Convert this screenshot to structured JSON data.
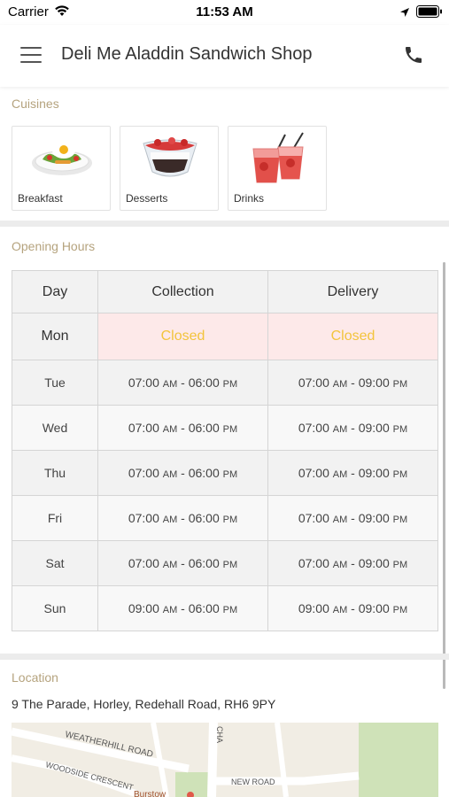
{
  "status_bar": {
    "carrier": "Carrier",
    "time": "11:53 AM"
  },
  "header": {
    "title": "Deli Me Aladdin Sandwich Shop"
  },
  "cuisines": {
    "label": "Cuisines",
    "items": [
      {
        "label": "Breakfast"
      },
      {
        "label": "Desserts"
      },
      {
        "label": "Drinks"
      }
    ]
  },
  "opening_hours": {
    "label": "Opening Hours",
    "headers": {
      "day": "Day",
      "collection": "Collection",
      "delivery": "Delivery"
    },
    "today": {
      "day": "Mon",
      "collection": "Closed",
      "delivery": "Closed"
    },
    "rows": [
      {
        "day": "Tue",
        "collection": {
          "open": "07:00",
          "open_ampm": "AM",
          "close": "06:00",
          "close_ampm": "PM"
        },
        "delivery": {
          "open": "07:00",
          "open_ampm": "AM",
          "close": "09:00",
          "close_ampm": "PM"
        }
      },
      {
        "day": "Wed",
        "collection": {
          "open": "07:00",
          "open_ampm": "AM",
          "close": "06:00",
          "close_ampm": "PM"
        },
        "delivery": {
          "open": "07:00",
          "open_ampm": "AM",
          "close": "09:00",
          "close_ampm": "PM"
        }
      },
      {
        "day": "Thu",
        "collection": {
          "open": "07:00",
          "open_ampm": "AM",
          "close": "06:00",
          "close_ampm": "PM"
        },
        "delivery": {
          "open": "07:00",
          "open_ampm": "AM",
          "close": "09:00",
          "close_ampm": "PM"
        }
      },
      {
        "day": "Fri",
        "collection": {
          "open": "07:00",
          "open_ampm": "AM",
          "close": "06:00",
          "close_ampm": "PM"
        },
        "delivery": {
          "open": "07:00",
          "open_ampm": "AM",
          "close": "09:00",
          "close_ampm": "PM"
        }
      },
      {
        "day": "Sat",
        "collection": {
          "open": "07:00",
          "open_ampm": "AM",
          "close": "06:00",
          "close_ampm": "PM"
        },
        "delivery": {
          "open": "07:00",
          "open_ampm": "AM",
          "close": "09:00",
          "close_ampm": "PM"
        }
      },
      {
        "day": "Sun",
        "collection": {
          "open": "09:00",
          "open_ampm": "AM",
          "close": "06:00",
          "close_ampm": "PM"
        },
        "delivery": {
          "open": "09:00",
          "open_ampm": "AM",
          "close": "09:00",
          "close_ampm": "PM"
        }
      }
    ]
  },
  "location": {
    "label": "Location",
    "address": "9 The Parade, Horley, Redehall Road, RH6 9PY",
    "map_labels": {
      "road1": "WEATHERHILL ROAD",
      "road2": "WOODSIDE CRESCENT",
      "road3": "NEW ROAD",
      "road4": "CHA",
      "place": "Burstow"
    }
  },
  "colors": {
    "accent": "#b5a37e",
    "closed_text": "#f3c43c",
    "closed_bg": "#fde9e9"
  }
}
